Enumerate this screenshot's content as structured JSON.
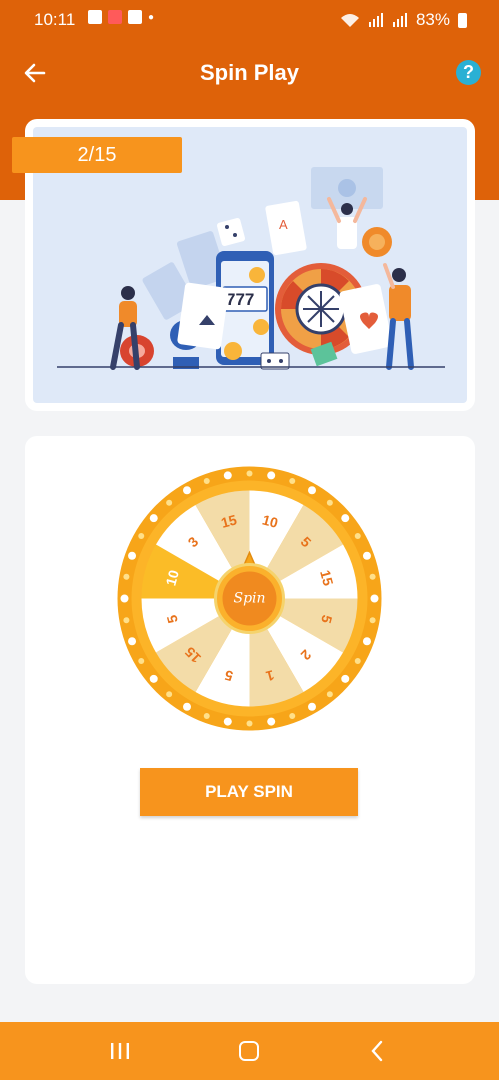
{
  "status_bar": {
    "time": "10:11",
    "battery": "83%"
  },
  "header": {
    "title": "Spin Play"
  },
  "banner": {
    "progress": "2/15",
    "slot_text": "777"
  },
  "wheel": {
    "center_label": "Spin",
    "segments": [
      "10",
      "5",
      "15",
      "5",
      "2",
      "1",
      "5",
      "15",
      "5",
      "10",
      "3",
      "15"
    ]
  },
  "actions": {
    "play_label": "PLAY SPIN"
  },
  "colors": {
    "primary": "#de6209",
    "accent": "#f7941d",
    "help": "#2ab0d4"
  }
}
